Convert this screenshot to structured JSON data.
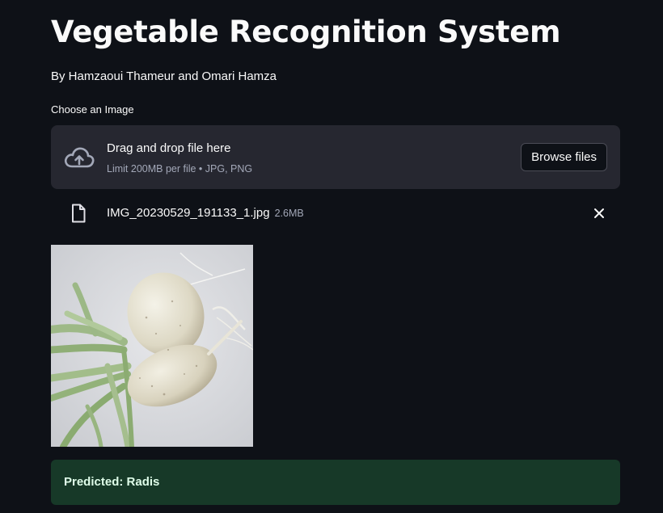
{
  "header": {
    "title": "Vegetable Recognition System",
    "byline": "By Hamzaoui Thameur and Omari Hamza"
  },
  "uploader": {
    "label": "Choose an Image",
    "drop_title": "Drag and drop file here",
    "limit_text": "Limit 200MB per file • JPG, PNG",
    "browse_label": "Browse files"
  },
  "uploaded_file": {
    "name": "IMG_20230529_191133_1.jpg",
    "size": "2.6MB"
  },
  "result": {
    "message": "Predicted: Radis"
  },
  "colors": {
    "background": "#0e1117",
    "surface": "#262730",
    "success_bg": "#173928",
    "success_text": "#dffde9"
  }
}
